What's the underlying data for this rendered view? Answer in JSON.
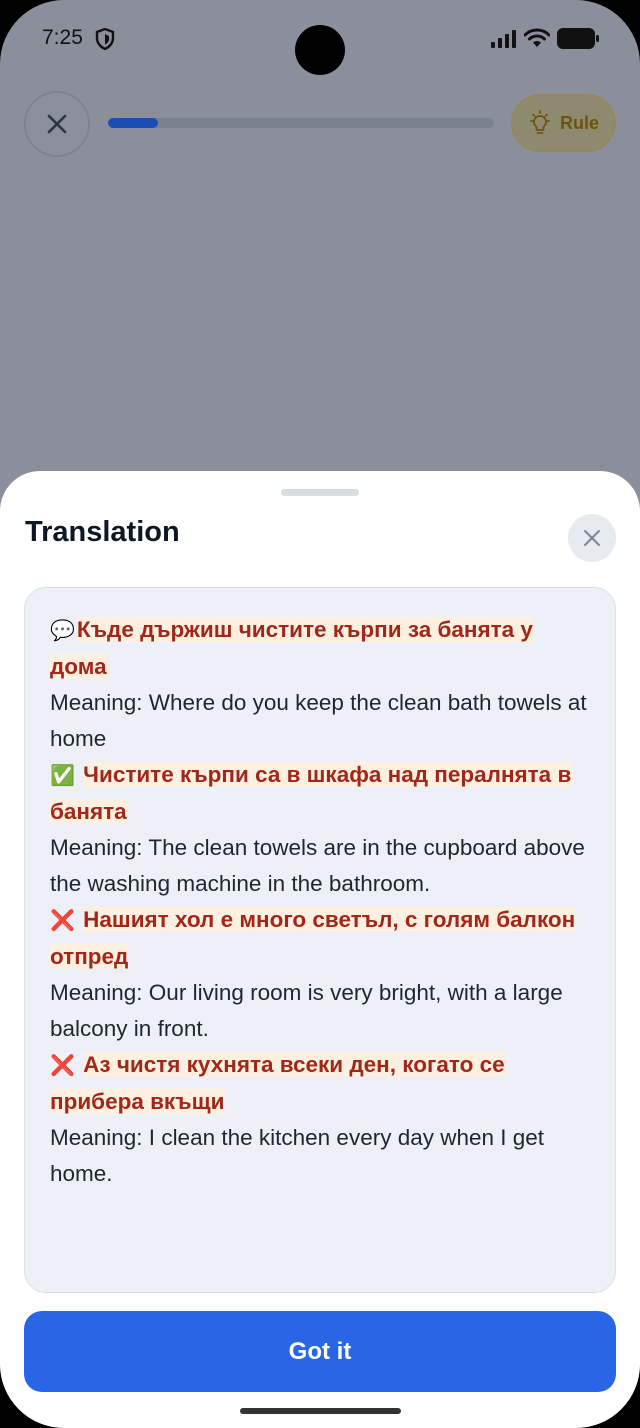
{
  "status_bar": {
    "time": "7:25"
  },
  "top_bar": {
    "progress": 0.13,
    "rule_label": "Rule"
  },
  "sheet": {
    "title": "Translation",
    "button_label": "Got it",
    "entries": [
      {
        "icon": "💬",
        "sentence": "Къде държиш чистите кърпи за банята у дома",
        "meaning": "Meaning: Where do you keep the clean bath towels at home"
      },
      {
        "icon": "✅",
        "sentence": "Чистите кърпи са в шкафа над пералнята в банята",
        "meaning": "Meaning: The clean towels are in the cupboard above the washing machine in the bathroom."
      },
      {
        "icon": "❌",
        "sentence": "Нашият хол е много светъл, с голям балкон отпред",
        "meaning": "Meaning: Our living room is very bright, with a large balcony in front."
      },
      {
        "icon": "❌",
        "sentence": "Аз чистя кухнята всеки ден, когато се прибера вкъщи",
        "meaning": "Meaning: I clean the kitchen every day when I get home."
      }
    ]
  }
}
